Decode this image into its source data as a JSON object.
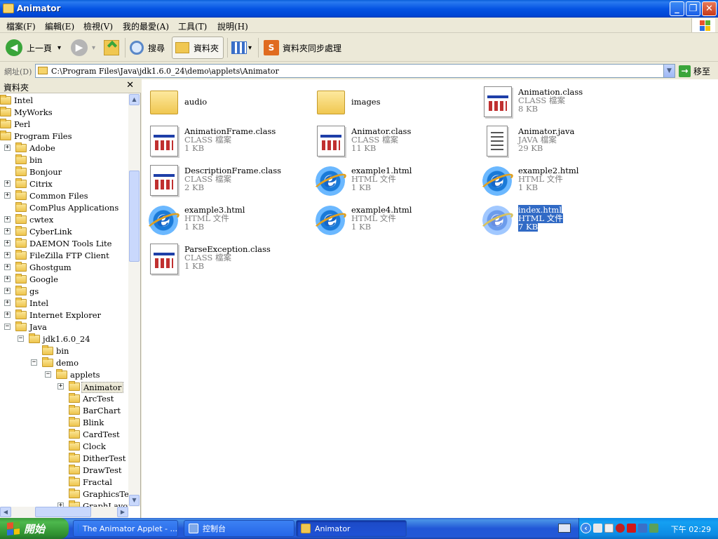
{
  "window": {
    "title": "Animator"
  },
  "titlebar_buttons": {
    "minimize": "_",
    "maximize": "❐",
    "close": "✕"
  },
  "menu": [
    "檔案(F)",
    "編輯(E)",
    "檢視(V)",
    "我的最愛(A)",
    "工具(T)",
    "說明(H)"
  ],
  "toolbar": {
    "back": "上一頁",
    "back_icon": "◀",
    "forward_icon": "▶",
    "dropdown_icon": "▾",
    "search": "搜尋",
    "folders": "資料夾",
    "sync": "資料夾同步處理",
    "sync_icon_letter": "S"
  },
  "address": {
    "label": "網址(D)",
    "path": "C:\\Program Files\\Java\\jdk1.6.0_24\\demo\\applets\\Animator",
    "dropdown_icon": "▼",
    "go_label": "移至",
    "go_icon": "→"
  },
  "folder_pane": {
    "title": "資料夾",
    "close_icon": "✕",
    "expand_icon": "+",
    "collapse_icon": "−",
    "scroll_up_icon": "▲",
    "scroll_down_icon": "▼",
    "scroll_left_icon": "◀",
    "scroll_right_icon": "▶",
    "tree": [
      {
        "label": "Intel",
        "level": 0,
        "exp": ""
      },
      {
        "label": "MyWorks",
        "level": 0,
        "exp": ""
      },
      {
        "label": "Perl",
        "level": 0,
        "exp": ""
      },
      {
        "label": "Program Files",
        "level": 0,
        "exp": ""
      },
      {
        "label": "Adobe",
        "level": 1,
        "exp": "+"
      },
      {
        "label": "bin",
        "level": 1,
        "exp": ""
      },
      {
        "label": "Bonjour",
        "level": 1,
        "exp": ""
      },
      {
        "label": "Citrix",
        "level": 1,
        "exp": "+"
      },
      {
        "label": "Common Files",
        "level": 1,
        "exp": "+"
      },
      {
        "label": "ComPlus Applications",
        "level": 1,
        "exp": ""
      },
      {
        "label": "cwtex",
        "level": 1,
        "exp": "+"
      },
      {
        "label": "CyberLink",
        "level": 1,
        "exp": "+"
      },
      {
        "label": "DAEMON Tools Lite",
        "level": 1,
        "exp": "+"
      },
      {
        "label": "FileZilla FTP Client",
        "level": 1,
        "exp": "+"
      },
      {
        "label": "Ghostgum",
        "level": 1,
        "exp": "+"
      },
      {
        "label": "Google",
        "level": 1,
        "exp": "+"
      },
      {
        "label": "gs",
        "level": 1,
        "exp": "+"
      },
      {
        "label": "Intel",
        "level": 1,
        "exp": "+"
      },
      {
        "label": "Internet Explorer",
        "level": 1,
        "exp": "+"
      },
      {
        "label": "Java",
        "level": 1,
        "exp": "−"
      },
      {
        "label": "jdk1.6.0_24",
        "level": 2,
        "exp": "−"
      },
      {
        "label": "bin",
        "level": 3,
        "exp": ""
      },
      {
        "label": "demo",
        "level": 3,
        "exp": "−"
      },
      {
        "label": "applets",
        "level": 4,
        "exp": "−"
      },
      {
        "label": "Animator",
        "level": 5,
        "exp": "+",
        "selected": true
      },
      {
        "label": "ArcTest",
        "level": 5,
        "exp": ""
      },
      {
        "label": "BarChart",
        "level": 5,
        "exp": ""
      },
      {
        "label": "Blink",
        "level": 5,
        "exp": ""
      },
      {
        "label": "CardTest",
        "level": 5,
        "exp": ""
      },
      {
        "label": "Clock",
        "level": 5,
        "exp": ""
      },
      {
        "label": "DitherTest",
        "level": 5,
        "exp": ""
      },
      {
        "label": "DrawTest",
        "level": 5,
        "exp": ""
      },
      {
        "label": "Fractal",
        "level": 5,
        "exp": ""
      },
      {
        "label": "GraphicsTest",
        "level": 5,
        "exp": ""
      },
      {
        "label": "GraphLayout",
        "level": 5,
        "exp": "+"
      }
    ]
  },
  "files": [
    {
      "name": "audio",
      "type": "",
      "size": "",
      "icon": "folder-icon"
    },
    {
      "name": "images",
      "type": "",
      "size": "",
      "icon": "folder-icon"
    },
    {
      "name": "Animation.class",
      "type": "CLASS 檔案",
      "size": "8 KB",
      "icon": "class-file-icon"
    },
    {
      "name": "AnimationFrame.class",
      "type": "CLASS 檔案",
      "size": "1 KB",
      "icon": "class-file-icon"
    },
    {
      "name": "Animator.class",
      "type": "CLASS 檔案",
      "size": "11 KB",
      "icon": "class-file-icon"
    },
    {
      "name": "Animator.java",
      "type": "JAVA 檔案",
      "size": "29 KB",
      "icon": "java-file-icon"
    },
    {
      "name": "DescriptionFrame.class",
      "type": "CLASS 檔案",
      "size": "2 KB",
      "icon": "class-file-icon"
    },
    {
      "name": "example1.html",
      "type": "HTML 文件",
      "size": "1 KB",
      "icon": "ie-html-icon"
    },
    {
      "name": "example2.html",
      "type": "HTML 文件",
      "size": "1 KB",
      "icon": "ie-html-icon"
    },
    {
      "name": "example3.html",
      "type": "HTML 文件",
      "size": "1 KB",
      "icon": "ie-html-icon"
    },
    {
      "name": "example4.html",
      "type": "HTML 文件",
      "size": "1 KB",
      "icon": "ie-html-icon"
    },
    {
      "name": "index.html",
      "type": "HTML 文件",
      "size": "7 KB",
      "icon": "ie-html-icon",
      "selected": true
    },
    {
      "name": "ParseException.class",
      "type": "CLASS 檔案",
      "size": "1 KB",
      "icon": "class-file-icon"
    }
  ],
  "taskbar": {
    "start": "開始",
    "tasks": [
      {
        "label": "The Animator Applet - ...",
        "icon": "ie-icon",
        "active": false
      },
      {
        "label": "控制台",
        "icon": "control-panel-icon",
        "active": false
      },
      {
        "label": "Animator",
        "icon": "folder-icon",
        "active": true
      }
    ],
    "tray_expand_icon": "‹",
    "clock": "下午 02:29"
  },
  "colors": {
    "titlebar": "#0554e3",
    "selection": "#316ac5",
    "taskbar": "#245edb",
    "start": "#3c9a3c"
  }
}
